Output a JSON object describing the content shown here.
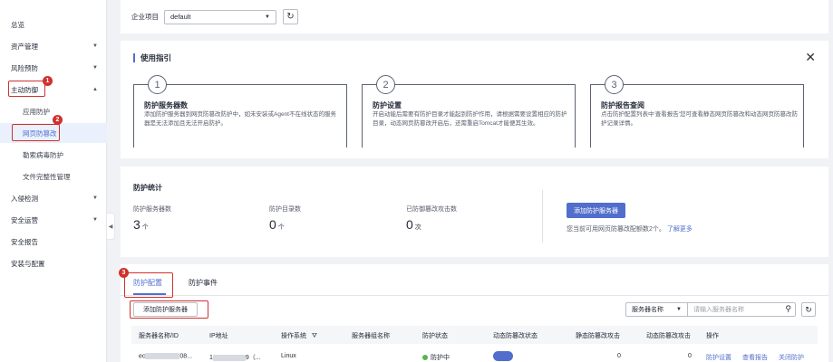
{
  "sidebar": {
    "items": [
      {
        "label": "总览",
        "chevron": false,
        "sub": false
      },
      {
        "label": "资产管理",
        "chevron": true,
        "sub": false
      },
      {
        "label": "风险预防",
        "chevron": true,
        "sub": false
      },
      {
        "label": "主动防御",
        "chevron": true,
        "sub": false,
        "expanded": true
      },
      {
        "label": "应用防护",
        "chevron": false,
        "sub": true
      },
      {
        "label": "网页防篡改",
        "chevron": false,
        "sub": true,
        "active": true
      },
      {
        "label": "勒索病毒防护",
        "chevron": false,
        "sub": true
      },
      {
        "label": "文件完整性管理",
        "chevron": false,
        "sub": true
      },
      {
        "label": "入侵检测",
        "chevron": true,
        "sub": false
      },
      {
        "label": "安全运营",
        "chevron": true,
        "sub": false
      },
      {
        "label": "安全报告",
        "chevron": false,
        "sub": false
      },
      {
        "label": "安装与配置",
        "chevron": false,
        "sub": false
      }
    ]
  },
  "markers": [
    "1",
    "2",
    "3"
  ],
  "top": {
    "project_label": "企业项目",
    "project_value": "default"
  },
  "guide": {
    "title": "使用指引",
    "steps": [
      {
        "num": "1",
        "title": "防护服务器数",
        "desc": "添加防护服务器到网页防篡改防护中，如未安装或Agent不在线状态的服务器是无法添加且无法开启防护。"
      },
      {
        "num": "2",
        "title": "防护设置",
        "desc": "开启动能后需要有防护目录才能起到防护作用，请根据需要设置相应的防护目录，动态网页防篡改开启后，还需重启Tomcat才能便其生效。"
      },
      {
        "num": "3",
        "title": "防护报告查阅",
        "desc": "点击防护配置列表中'查看报告'您可查看静态网页防篡改和动态网页防篡改防护记录详情。"
      }
    ]
  },
  "stats": {
    "title": "防护统计",
    "items": [
      {
        "label": "防护服务器数",
        "value": "3",
        "unit": "个"
      },
      {
        "label": "防护目录数",
        "value": "0",
        "unit": "个"
      },
      {
        "label": "已防御篡改攻击数",
        "value": "0",
        "unit": "次"
      }
    ],
    "add_button": "添加防护服务器",
    "quota_text": "您当前可用网页防篡改配额数2个。",
    "quota_link": "了解更多"
  },
  "config": {
    "tabs": [
      "防护配置",
      "防护事件"
    ],
    "add_button": "添加防护服务器",
    "search_field": "服务器名称",
    "search_placeholder": "请输入服务器名称",
    "columns": [
      "服务器名称/ID",
      "IP地址",
      "操作系统",
      "服务器组名称",
      "防护状态",
      "动态防篡改状态",
      "静态防篡改攻击",
      "动态防篡改攻击",
      "操作"
    ],
    "row": {
      "name_prefix": "ec",
      "name_suffix": "08...",
      "ip_prefix": "1",
      "ip_suffix": "9（...",
      "os": "Linux",
      "status": "防护中",
      "static": "0",
      "dynamic": "0",
      "actions": [
        "防护设置",
        "查看报告",
        "关闭防护"
      ]
    }
  },
  "colors": {
    "accent": "#526ecc",
    "marker": "#d0312d",
    "success": "#5ab34b"
  }
}
